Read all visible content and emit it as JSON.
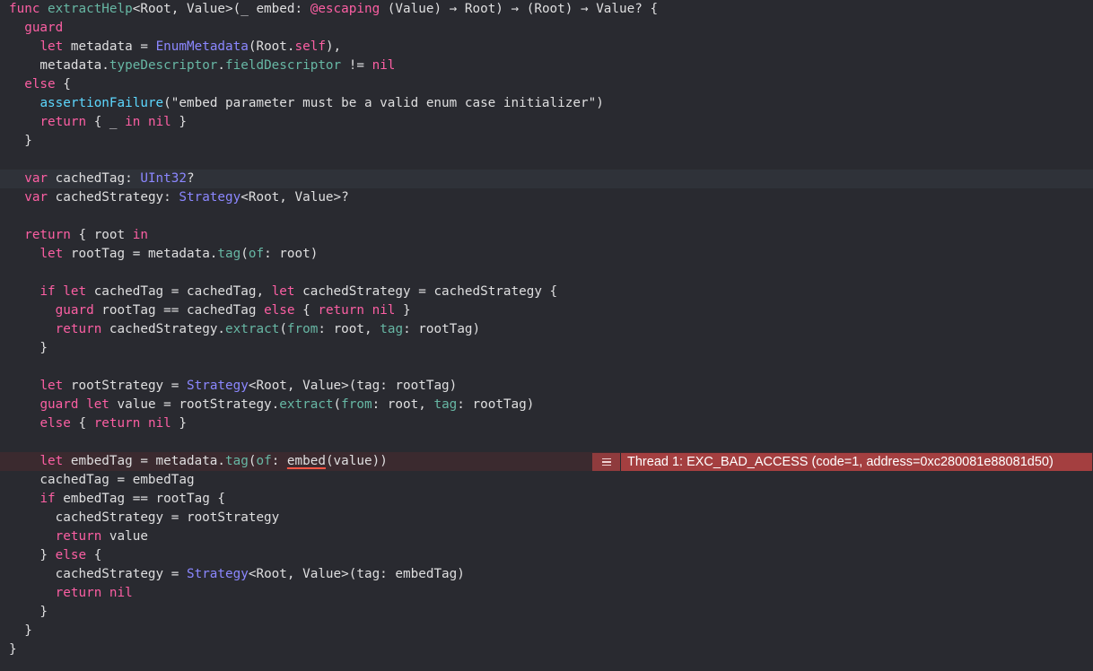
{
  "editor": {
    "colors": {
      "background": "#292a30",
      "current_line": "#2f3239",
      "error_line": "#3b2a2f",
      "keyword": "#fc5fa3",
      "function": "#67b7a4",
      "type": "#5dd8ff",
      "plain": "#dfdfe0",
      "error_badge": "#a43f40"
    },
    "lines": [
      {
        "tokens": [
          [
            "kw",
            "func "
          ],
          [
            "fn",
            "extractHelp"
          ],
          [
            "pn",
            "<Root, Value>(_ embed: "
          ],
          [
            "kw",
            "@escaping"
          ],
          [
            "pn",
            " (Value) → Root) → (Root) → Value? {"
          ]
        ]
      },
      {
        "tokens": [
          [
            "pn",
            "  "
          ],
          [
            "kw",
            "guard"
          ]
        ]
      },
      {
        "tokens": [
          [
            "pn",
            "    "
          ],
          [
            "kw",
            "let"
          ],
          [
            "pn",
            " metadata = "
          ],
          [
            "tystd",
            "EnumMetadata"
          ],
          [
            "pn",
            "(Root."
          ],
          [
            "kw",
            "self"
          ],
          [
            "pn",
            "),"
          ]
        ]
      },
      {
        "tokens": [
          [
            "pn",
            "    metadata."
          ],
          [
            "fn",
            "typeDescriptor"
          ],
          [
            "pn",
            "."
          ],
          [
            "fn",
            "fieldDescriptor"
          ],
          [
            "pn",
            " != "
          ],
          [
            "kw",
            "nil"
          ]
        ]
      },
      {
        "tokens": [
          [
            "pn",
            "  "
          ],
          [
            "kw",
            "else"
          ],
          [
            "pn",
            " {"
          ]
        ]
      },
      {
        "tokens": [
          [
            "pn",
            "    "
          ],
          [
            "ty",
            "assertionFailure"
          ],
          [
            "pn",
            "(\"embed parameter must be a valid enum case initializer\")"
          ]
        ]
      },
      {
        "tokens": [
          [
            "pn",
            "    "
          ],
          [
            "kw",
            "return"
          ],
          [
            "pn",
            " { _ "
          ],
          [
            "kw",
            "in"
          ],
          [
            "pn",
            " "
          ],
          [
            "kw",
            "nil"
          ],
          [
            "pn",
            " }"
          ]
        ]
      },
      {
        "tokens": [
          [
            "pn",
            "  }"
          ]
        ]
      },
      {
        "tokens": [
          [
            "pn",
            ""
          ]
        ]
      },
      {
        "current": true,
        "tokens": [
          [
            "pn",
            "  "
          ],
          [
            "kw",
            "var"
          ],
          [
            "pn",
            " cachedTag: "
          ],
          [
            "tystd",
            "UInt32"
          ],
          [
            "pn",
            "?"
          ]
        ]
      },
      {
        "tokens": [
          [
            "pn",
            "  "
          ],
          [
            "kw",
            "var"
          ],
          [
            "pn",
            " cachedStrategy: "
          ],
          [
            "tystd",
            "Strategy"
          ],
          [
            "pn",
            "<Root, Value>?"
          ]
        ]
      },
      {
        "tokens": [
          [
            "pn",
            ""
          ]
        ]
      },
      {
        "tokens": [
          [
            "pn",
            "  "
          ],
          [
            "kw",
            "return"
          ],
          [
            "pn",
            " { root "
          ],
          [
            "kw",
            "in"
          ]
        ]
      },
      {
        "tokens": [
          [
            "pn",
            "    "
          ],
          [
            "kw",
            "let"
          ],
          [
            "pn",
            " rootTag = metadata."
          ],
          [
            "fn",
            "tag"
          ],
          [
            "pn",
            "("
          ],
          [
            "fn",
            "of"
          ],
          [
            "pn",
            ": root)"
          ]
        ]
      },
      {
        "tokens": [
          [
            "pn",
            ""
          ]
        ]
      },
      {
        "tokens": [
          [
            "pn",
            "    "
          ],
          [
            "kw",
            "if let"
          ],
          [
            "pn",
            " cachedTag = cachedTag, "
          ],
          [
            "kw",
            "let"
          ],
          [
            "pn",
            " cachedStrategy = cachedStrategy {"
          ]
        ]
      },
      {
        "tokens": [
          [
            "pn",
            "      "
          ],
          [
            "kw",
            "guard"
          ],
          [
            "pn",
            " rootTag == cachedTag "
          ],
          [
            "kw",
            "else"
          ],
          [
            "pn",
            " { "
          ],
          [
            "kw",
            "return nil"
          ],
          [
            "pn",
            " }"
          ]
        ]
      },
      {
        "tokens": [
          [
            "pn",
            "      "
          ],
          [
            "kw",
            "return"
          ],
          [
            "pn",
            " cachedStrategy."
          ],
          [
            "fn",
            "extract"
          ],
          [
            "pn",
            "("
          ],
          [
            "fn",
            "from"
          ],
          [
            "pn",
            ": root, "
          ],
          [
            "fn",
            "tag"
          ],
          [
            "pn",
            ": rootTag)"
          ]
        ]
      },
      {
        "tokens": [
          [
            "pn",
            "    }"
          ]
        ]
      },
      {
        "tokens": [
          [
            "pn",
            ""
          ]
        ]
      },
      {
        "tokens": [
          [
            "pn",
            "    "
          ],
          [
            "kw",
            "let"
          ],
          [
            "pn",
            " rootStrategy = "
          ],
          [
            "tystd",
            "Strategy"
          ],
          [
            "pn",
            "<Root, Value>(tag: rootTag)"
          ]
        ]
      },
      {
        "tokens": [
          [
            "pn",
            "    "
          ],
          [
            "kw",
            "guard let"
          ],
          [
            "pn",
            " value = rootStrategy."
          ],
          [
            "fn",
            "extract"
          ],
          [
            "pn",
            "("
          ],
          [
            "fn",
            "from"
          ],
          [
            "pn",
            ": root, "
          ],
          [
            "fn",
            "tag"
          ],
          [
            "pn",
            ": rootTag)"
          ]
        ]
      },
      {
        "tokens": [
          [
            "pn",
            "    "
          ],
          [
            "kw",
            "else"
          ],
          [
            "pn",
            " { "
          ],
          [
            "kw",
            "return nil"
          ],
          [
            "pn",
            " }"
          ]
        ]
      },
      {
        "tokens": [
          [
            "pn",
            ""
          ]
        ]
      },
      {
        "error": true,
        "tokens": [
          [
            "pn",
            "    "
          ],
          [
            "kw",
            "let"
          ],
          [
            "pn",
            " embedTag = metadata."
          ],
          [
            "fn",
            "tag"
          ],
          [
            "pn",
            "("
          ],
          [
            "fn",
            "of"
          ],
          [
            "pn",
            ": "
          ],
          [
            "err",
            "embed"
          ],
          [
            "pn",
            "(value))"
          ]
        ]
      },
      {
        "tokens": [
          [
            "pn",
            "    cachedTag = embedTag"
          ]
        ]
      },
      {
        "tokens": [
          [
            "pn",
            "    "
          ],
          [
            "kw",
            "if"
          ],
          [
            "pn",
            " embedTag == rootTag {"
          ]
        ]
      },
      {
        "tokens": [
          [
            "pn",
            "      cachedStrategy = rootStrategy"
          ]
        ]
      },
      {
        "tokens": [
          [
            "pn",
            "      "
          ],
          [
            "kw",
            "return"
          ],
          [
            "pn",
            " value"
          ]
        ]
      },
      {
        "tokens": [
          [
            "pn",
            "    } "
          ],
          [
            "kw",
            "else"
          ],
          [
            "pn",
            " {"
          ]
        ]
      },
      {
        "tokens": [
          [
            "pn",
            "      cachedStrategy = "
          ],
          [
            "tystd",
            "Strategy"
          ],
          [
            "pn",
            "<Root, Value>(tag: embedTag)"
          ]
        ]
      },
      {
        "tokens": [
          [
            "pn",
            "      "
          ],
          [
            "kw",
            "return nil"
          ]
        ]
      },
      {
        "tokens": [
          [
            "pn",
            "    }"
          ]
        ]
      },
      {
        "tokens": [
          [
            "pn",
            "  }"
          ]
        ]
      },
      {
        "tokens": [
          [
            "pn",
            "}"
          ]
        ]
      }
    ]
  },
  "error_annotation": {
    "icon": "error-lines-icon",
    "message": "Thread 1: EXC_BAD_ACCESS (code=1, address=0xc280081e88081d50)"
  }
}
